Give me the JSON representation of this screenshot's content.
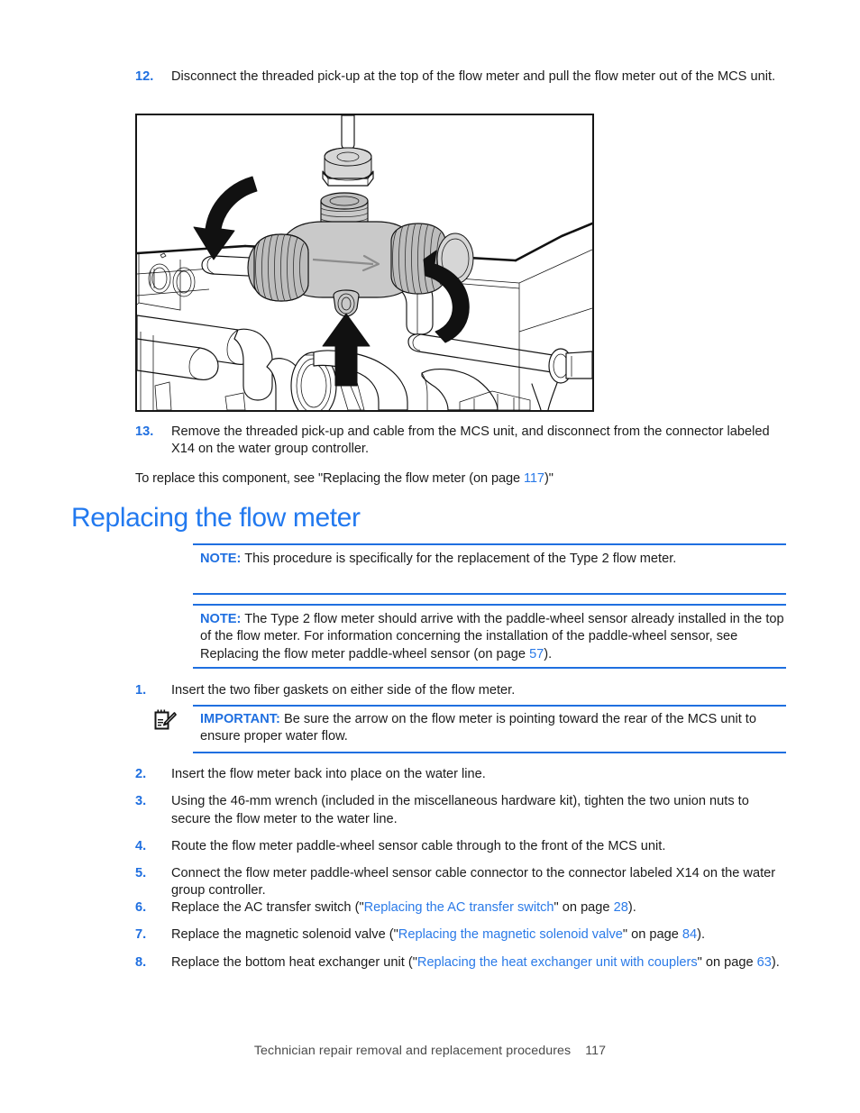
{
  "document": {
    "title": "Technician repair removal and replacement procedures",
    "page_number": "117"
  },
  "colors": {
    "heading_blue": "#2279ef",
    "accent_blue": "#1f6fe0",
    "link_blue": "#2a7ae8",
    "body_text": "#1b1b1b",
    "footer_text": "#4a4a4a"
  },
  "top_steps": [
    {
      "number": "12.",
      "text": "Disconnect the threaded pick-up at the top of the flow meter and pull the flow meter out of the MCS unit."
    },
    {
      "number": "13.",
      "text": "Remove the threaded pick-up and cable from the MCS unit, and disconnect from the connector labeled X14 on the water group controller."
    }
  ],
  "figure": {
    "caption_alt": "Line drawing of flow meter being removed from the MCS water line, with rotation arrows on both union nuts and an upward removal arrow",
    "flow_arrow_label": "flow-direction-arrow"
  },
  "cross_reference": {
    "prefix": "To replace this component, see \"Replacing the flow meter (on page ",
    "page": "117",
    "suffix": ")\""
  },
  "heading": {
    "text": "Replacing the flow meter"
  },
  "note_1": {
    "label": "NOTE:",
    "text": "This procedure is specifically for the replacement of the Type 2 flow meter."
  },
  "note_2": {
    "label": "NOTE:",
    "text_before": "The Type 2 flow meter should arrive with the paddle-wheel sensor already installed in the top of the flow meter. For information concerning the installation of the paddle-wheel sensor, see Replacing the flow meter paddle-wheel sensor (on page ",
    "page": "57",
    "text_after": ")."
  },
  "important": {
    "icon": "note-pencil-icon",
    "label": "IMPORTANT:",
    "text": "Be sure the arrow on the flow meter is pointing toward the rear of the MCS unit to ensure proper water flow."
  },
  "steps": [
    {
      "number": "1.",
      "text": "Insert the two fiber gaskets on either side of the flow meter."
    },
    {
      "number": "2.",
      "text": "Insert the flow meter back into place on the water line."
    },
    {
      "number": "3.",
      "text": "Using the 46-mm wrench (included in the miscellaneous hardware kit), tighten the two union nuts to secure the flow meter to the water line."
    },
    {
      "number": "4.",
      "text": "Route the flow meter paddle-wheel sensor cable through to the front of the MCS unit."
    },
    {
      "number": "5.",
      "text": "Connect the flow meter paddle-wheel sensor cable connector to the connector labeled X14 on the water group controller."
    },
    {
      "number": "6.",
      "prefix": "Replace the AC transfer switch (\"",
      "link": "Replacing the AC transfer switch",
      "middle": "\" on page ",
      "page": "28",
      "suffix": ")."
    },
    {
      "number": "7.",
      "prefix": "Replace the magnetic solenoid valve (\"",
      "link": "Replacing the magnetic solenoid valve",
      "middle": "\" on page ",
      "page": "84",
      "suffix": ")."
    },
    {
      "number": "8.",
      "prefix": "Replace the bottom heat exchanger unit (\"",
      "link": "Replacing the heat exchanger unit with couplers",
      "middle": "\" on page ",
      "page": "63",
      "suffix": ")."
    }
  ]
}
